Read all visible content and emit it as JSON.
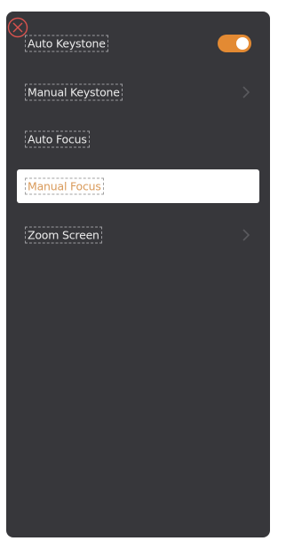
{
  "colors": {
    "panel": "#37373b",
    "accent": "#e38a33",
    "text": "#ececec",
    "selected_text": "#d99a5a",
    "selected_bg": "#ffffff",
    "close_icon": "#d9534f"
  },
  "menu": {
    "items": [
      {
        "label": "Auto Keystone",
        "control": "toggle",
        "toggle_on": true
      },
      {
        "label": "Manual Keystone",
        "control": "chevron"
      },
      {
        "label": "Auto Focus",
        "control": "none"
      },
      {
        "label": "Manual Focus",
        "control": "none",
        "selected": true
      },
      {
        "label": "Zoom Screen",
        "control": "chevron"
      }
    ]
  },
  "icons": {
    "close": "close-circle-icon",
    "chevron": "chevron-right-icon"
  }
}
